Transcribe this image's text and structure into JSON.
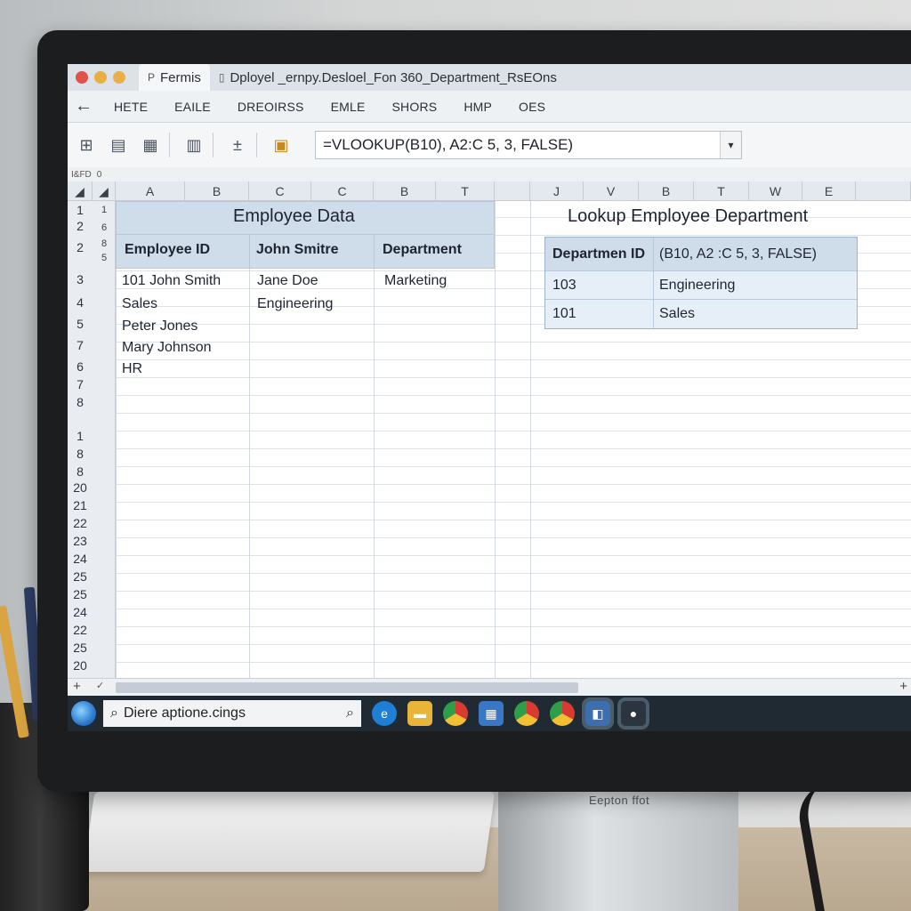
{
  "window": {
    "tabs": [
      {
        "icon": "P",
        "label": "Fermis"
      },
      {
        "icon": "▯",
        "label": "Dployel _ernpy.Desloel_Fon  360_Department_RsEOns"
      }
    ],
    "controls_colors": [
      "#e0524a",
      "#e7b040",
      "#e8b04a"
    ]
  },
  "menu": {
    "items": [
      "HETE",
      "EAILE",
      "DREOIRSS",
      "EMLE",
      "SHORS",
      "HMP",
      "OES"
    ]
  },
  "formula_bar": {
    "value": "=VLOOKUP(B10), A2:C 5, 3, FALSE)",
    "namebox": "I&FD",
    "namebox2": "0"
  },
  "columns": [
    "A",
    "B",
    "C",
    "C",
    "B",
    "T",
    "J",
    "V",
    "B",
    "T",
    "W",
    "E"
  ],
  "rows": {
    "main": [
      "1",
      "2",
      "2",
      "3",
      "4",
      "5",
      "7",
      "6",
      "7",
      "8",
      "1",
      "8",
      "8",
      "20",
      "21",
      "22",
      "23",
      "24",
      "25",
      "25",
      "24",
      "22",
      "25",
      "20"
    ],
    "sub": [
      "1",
      "6",
      "8",
      "5"
    ]
  },
  "employee_table": {
    "title": "Employee Data",
    "headers": [
      "Employee ID",
      "John Smitre",
      "Department"
    ],
    "col_a": [
      "101 John Smith",
      "Sales",
      "Peter Jones",
      "Mary Johnson",
      "HR"
    ],
    "col_b": [
      "Jane Doe",
      "Engineering"
    ],
    "col_c": [
      "Marketing"
    ]
  },
  "lookup_table": {
    "title": "Lookup Employee Department",
    "header": [
      "Departmen ID",
      "(B10, A2 :C 5, 3, FALSE)"
    ],
    "rows": [
      [
        "103",
        "Engineering"
      ],
      [
        "101",
        "Sales"
      ]
    ]
  },
  "taskbar": {
    "search_text": "Diere aptione.cings",
    "apps": [
      "edge-icon",
      "folder-icon",
      "chrome-icon",
      "network-icon",
      "chrome-icon",
      "chrome-icon",
      "store-icon",
      "steam-icon"
    ]
  },
  "monitor": {
    "brand": "Eepton ffot"
  }
}
